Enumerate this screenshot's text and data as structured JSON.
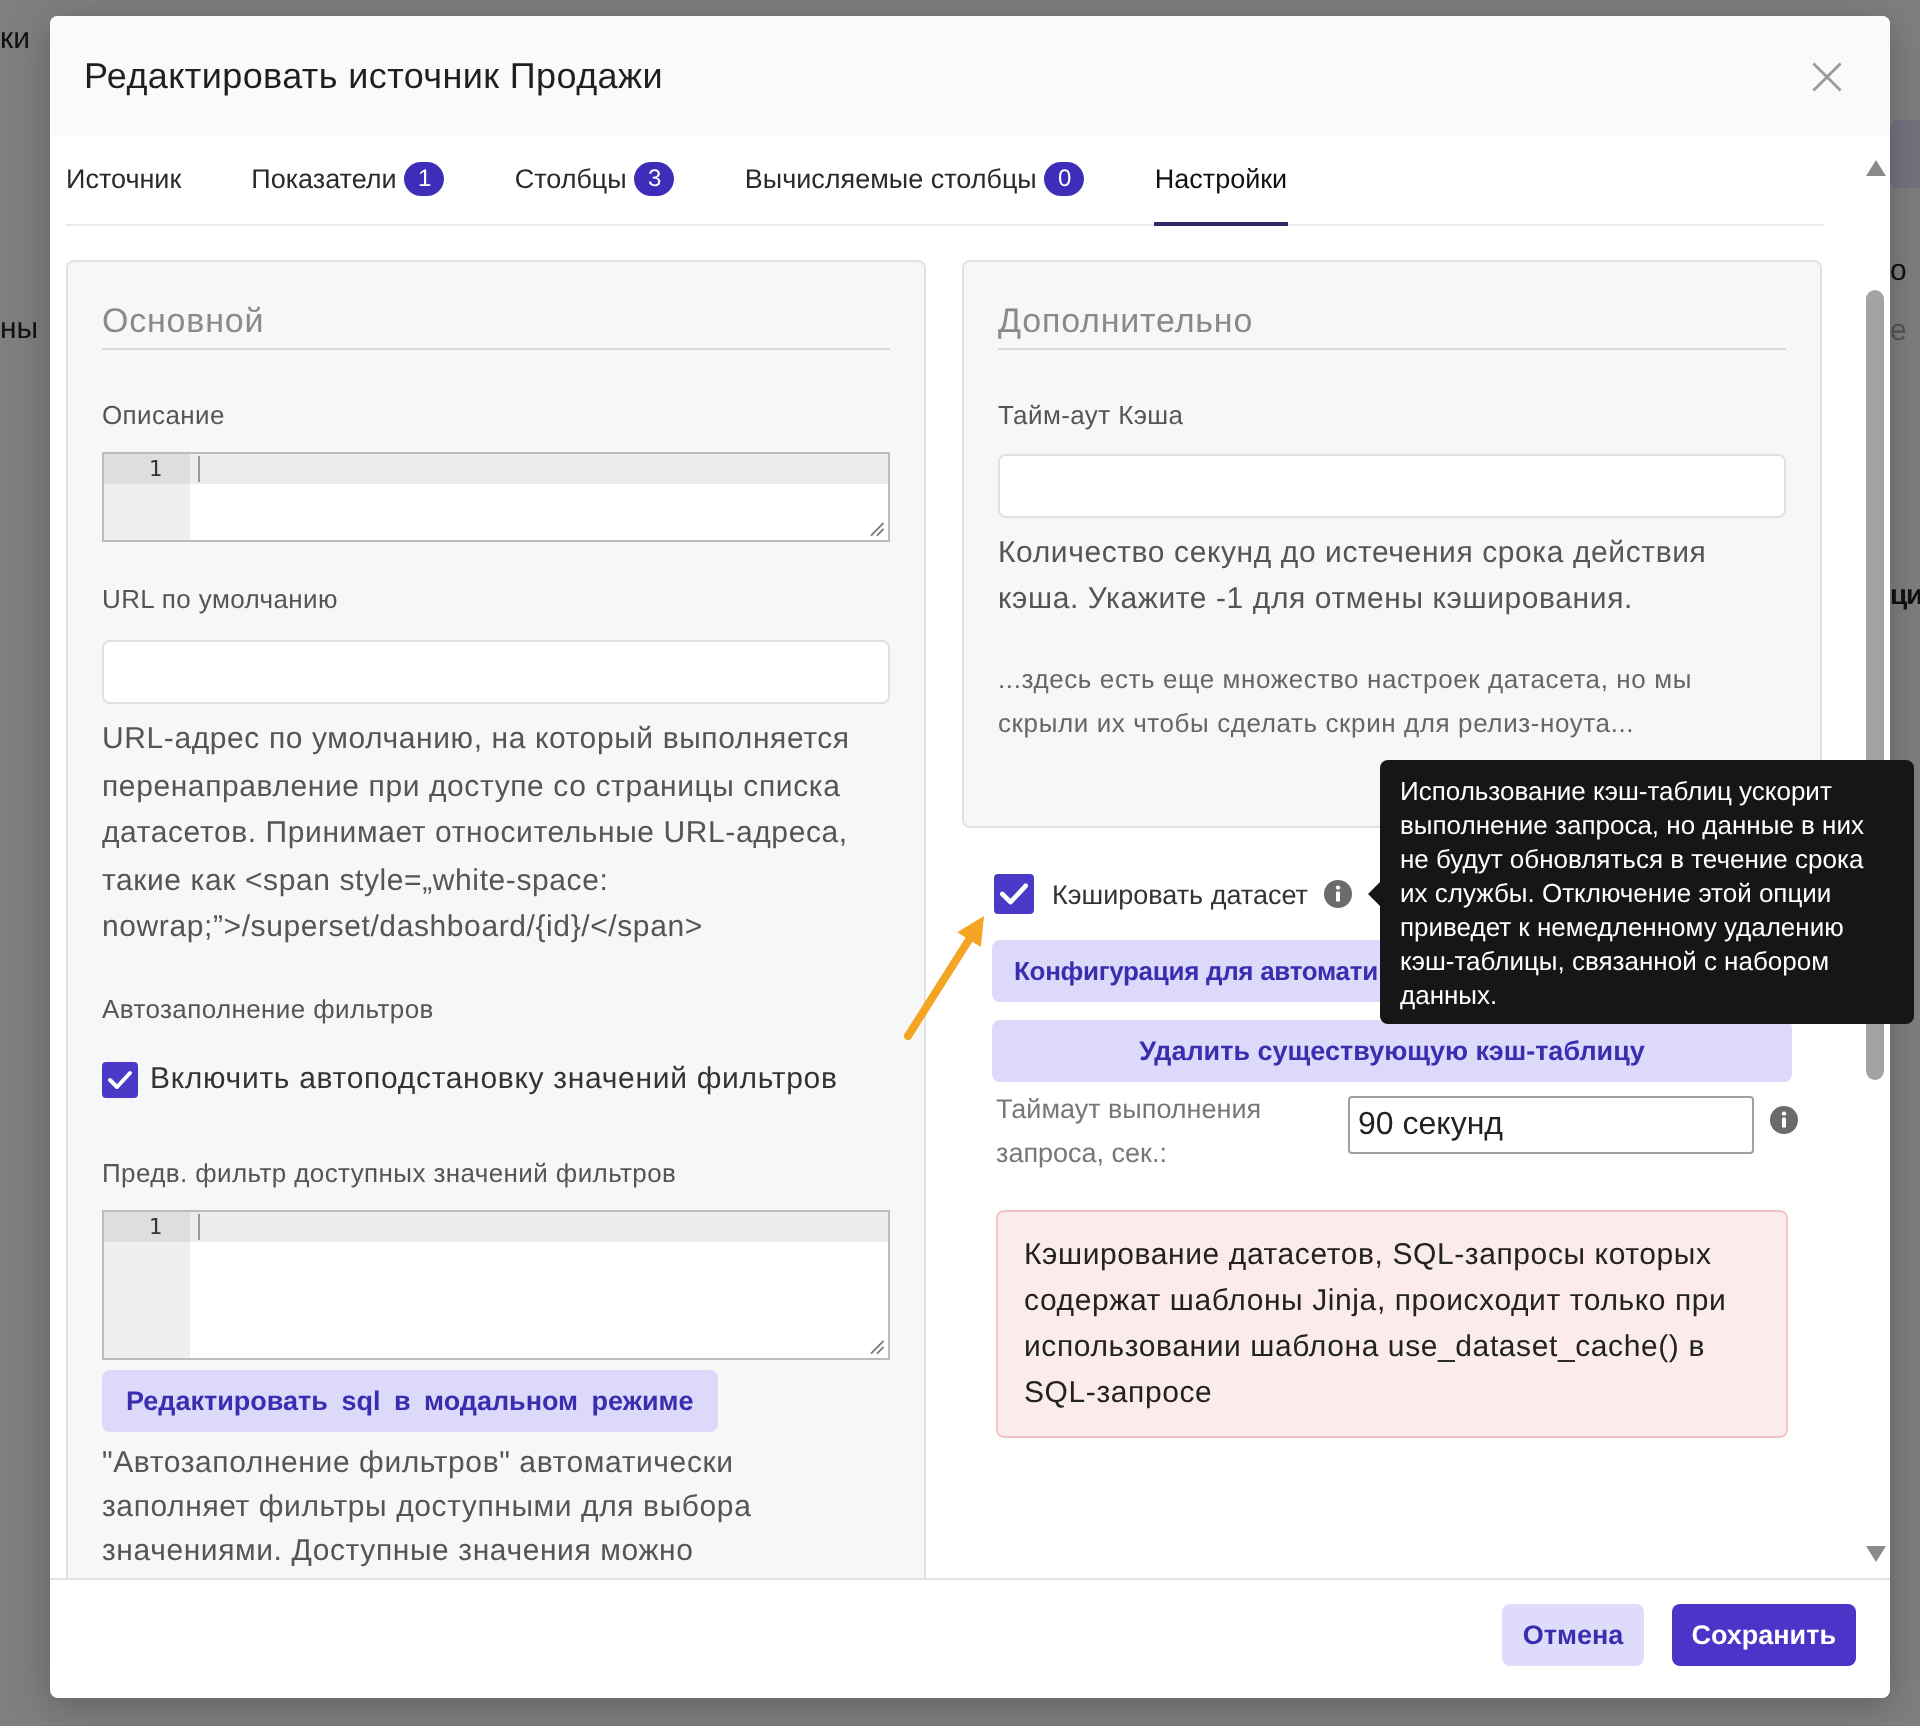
{
  "background_page": {
    "left_texts": [
      "ки",
      "ны"
    ],
    "right_texts": [
      "о",
      "е",
      "ци"
    ]
  },
  "dialog": {
    "title": "Редактировать источник Продажи"
  },
  "tabs": [
    {
      "label": "Источник",
      "selected": false
    },
    {
      "label": "Показатели",
      "count": "1",
      "selected": false
    },
    {
      "label": "Столбцы",
      "count": "3",
      "selected": false
    },
    {
      "label": "Вычисляемые столбцы",
      "count": "0",
      "selected": false
    },
    {
      "label": "Настройки",
      "selected": true
    }
  ],
  "basic": {
    "heading": "Основной",
    "description": {
      "label": "Описание",
      "line_number": "1"
    },
    "default_url": {
      "label": "URL по умолчанию",
      "help": "URL-адрес по умолчанию, на который выполняется перенаправление при доступе со страницы списка датасетов. Принимает относительные URL-адреса, такие как <span style=„white-space: nowrap;”>/superset/dashboard/{id}/</span>"
    },
    "autocomplete": {
      "label": "Автозаполнение фильтров",
      "checkbox_label": "Включить автоподстановку значений фильтров",
      "checked": true
    },
    "prefilter": {
      "label": "Предв. фильтр доступных значений фильтров",
      "line_number": "1",
      "button": "Редактировать sql в модальном режиме",
      "help": "\"Автозаполнение фильтров\" автоматически заполняет фильтры доступными для выбора значениями. Доступные значения можно"
    }
  },
  "advanced": {
    "heading": "Дополнительно",
    "cache_timeout": {
      "label": "Тайм-аут Кэша",
      "help": "Количество секунд до истечения срока действия кэша. Укажите -1 для отмены кэширования."
    },
    "note": "...здесь есть еще множество настроек датасета, но мы скрыли их чтобы сделать скрин для релиз-ноута..."
  },
  "cache": {
    "label": "Кэшировать датасет",
    "checked": true,
    "tooltip": "Использование кэш-таблиц ускорит выполнение запроса, но данные в них не будут обновляться в течение срока их службы. Отключение этой опции приведет к немедленному удалению кэш-таблицы, связанной с набором данных.",
    "buttons": [
      "Конфигурация для автомати",
      "Удалить существующую кэш-таблицу"
    ]
  },
  "query_timeout": {
    "label": "Таймаут выполнения запроса, сек.:",
    "value": "90 секунд"
  },
  "alert": "Кэширование датасетов, SQL-запросы которых содержат шаблоны Jinja, происходит только при использовании шаблона use_dataset_cache() в SQL-запросе",
  "footer_buttons": [
    {
      "label": "Отмена",
      "kind": "secondary"
    },
    {
      "label": "Сохранить",
      "kind": "primary"
    }
  ]
}
